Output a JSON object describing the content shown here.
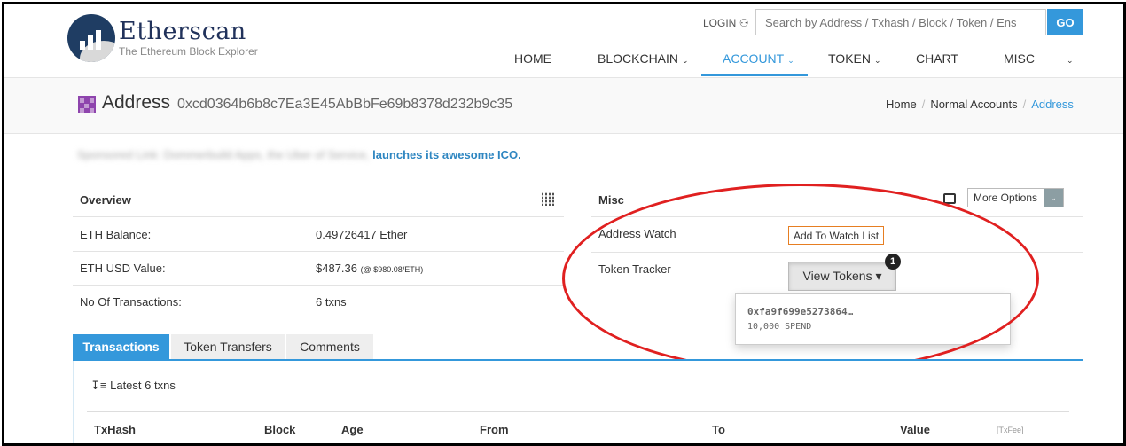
{
  "header": {
    "brand": "Etherscan",
    "tagline": "The Ethereum Block Explorer",
    "login": "LOGIN",
    "search_placeholder": "Search by Address / Txhash / Block / Token / Ens",
    "go": "GO"
  },
  "nav": [
    {
      "label": "HOME"
    },
    {
      "label": "BLOCKCHAIN"
    },
    {
      "label": "ACCOUNT",
      "active": true
    },
    {
      "label": "TOKEN"
    },
    {
      "label": "CHART"
    },
    {
      "label": "MISC"
    }
  ],
  "page": {
    "title": "Address",
    "address": "0xcd0364b6b8c7Ea3E45AbBbFe69b8378d232b9c35",
    "breadcrumb": [
      "Home",
      "Normal Accounts",
      "Address"
    ]
  },
  "sponsored": {
    "blurred": "Sponsored Link: Dommerbuild Apps, the Uber of Service,",
    "link": "launches its awesome ICO."
  },
  "overview": {
    "title": "Overview",
    "rows": [
      {
        "label": "ETH Balance:",
        "value": "0.49726417 Ether",
        "note": ""
      },
      {
        "label": "ETH USD Value:",
        "value": "$487.36",
        "note": "(@ $980.08/ETH)"
      },
      {
        "label": "No Of Transactions:",
        "value": "6 txns",
        "note": ""
      }
    ]
  },
  "misc": {
    "title": "Misc",
    "more_options": "More Options",
    "address_watch_label": "Address Watch",
    "watch_button": "Add To Watch List",
    "token_tracker_label": "Token Tracker",
    "view_tokens": "View Tokens",
    "badge": "1",
    "dropdown": {
      "address": "0xfa9f699e5273864…",
      "amount": "10,000 SPEND"
    }
  },
  "tabs": [
    {
      "label": "Transactions",
      "active": true
    },
    {
      "label": "Token Transfers"
    },
    {
      "label": "Comments"
    }
  ],
  "transactions": {
    "latest": "Latest 6 txns",
    "columns": [
      "TxHash",
      "Block",
      "Age",
      "From",
      "To",
      "Value",
      "[TxFee]"
    ]
  },
  "colors": {
    "accent": "#3498db",
    "annotation": "#e02020"
  }
}
